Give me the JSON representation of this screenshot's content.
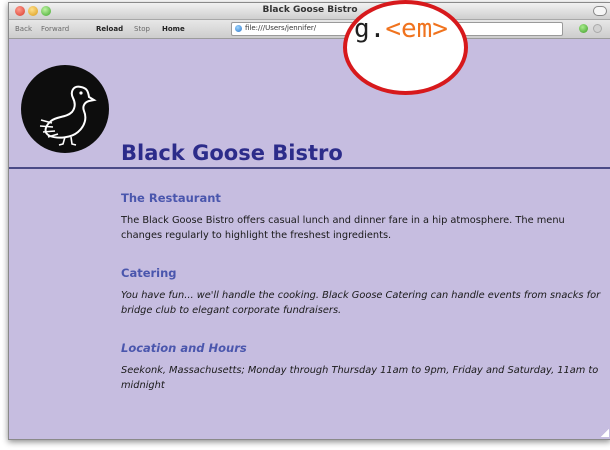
{
  "window": {
    "title": "Black Goose Bistro"
  },
  "toolbar": {
    "back": "Back",
    "forward": "Forward",
    "reload": "Reload",
    "stop": "Stop",
    "home": "Home",
    "url": "file:///Users/jennifer/"
  },
  "callout": {
    "before": "g.",
    "tag": "<em>"
  },
  "page": {
    "title": "Black Goose Bistro",
    "sections": [
      {
        "heading": "The Restaurant",
        "text": "The Black Goose Bistro offers casual lunch and dinner fare in a hip atmosphere. The menu changes regularly to highlight the freshest ingredients."
      },
      {
        "heading": "Catering",
        "text": "You have fun... we'll handle the cooking. Black Goose Catering can handle events from snacks for bridge club to elegant corporate fundraisers."
      },
      {
        "heading": "Location and Hours",
        "text": "Seekonk, Massachusetts; Monday through Thursday 11am to 9pm, Friday and Saturday, 11am to midnight"
      }
    ]
  },
  "colors": {
    "page_background": "#c6bde0",
    "title": "#2c2c8a",
    "heading": "#4a56ad",
    "callout_ring": "#d7191c",
    "callout_tag": "#f0731e"
  }
}
